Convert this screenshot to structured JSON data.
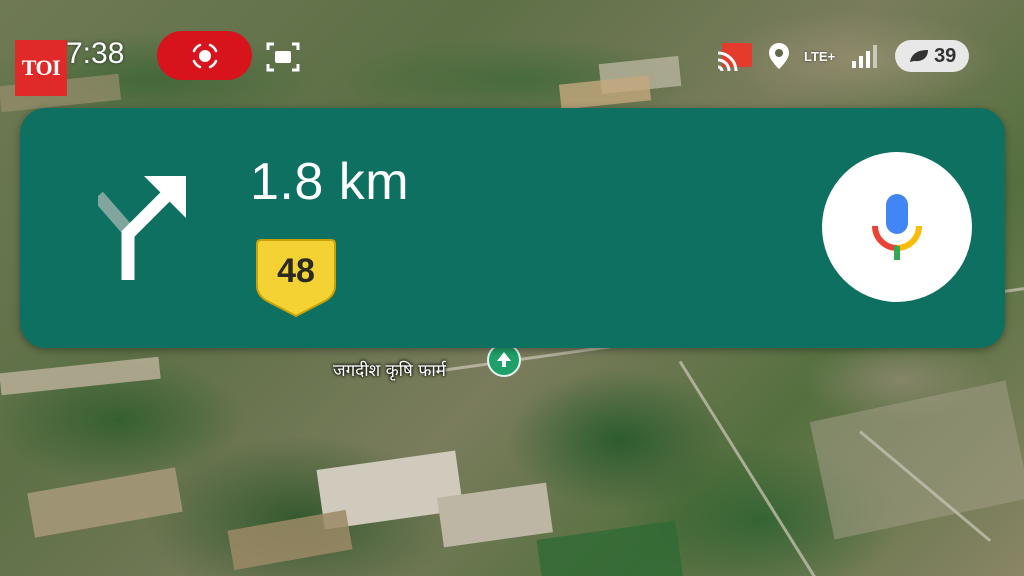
{
  "status_bar": {
    "brand_logo": "TOI",
    "time": "7:38",
    "network_label": "LTE+",
    "battery_level": "39",
    "icons": [
      "screen-record-icon",
      "screenshot-icon",
      "cast-icon",
      "location-icon",
      "signal-icon",
      "battery-saver-icon"
    ]
  },
  "navigation": {
    "distance": "1.8 km",
    "route_shield": "48",
    "maneuver_icon": "turn-slight-right-icon",
    "voice_icon": "microphone-icon"
  },
  "map": {
    "place_label": "जगदीश कृषि फार्म",
    "place_icon": "park-pin-icon"
  },
  "colors": {
    "nav_card": "#0e7060",
    "record_pill": "#d7141c",
    "brand_logo": "#e02a2a",
    "shield": "#f4d233"
  }
}
